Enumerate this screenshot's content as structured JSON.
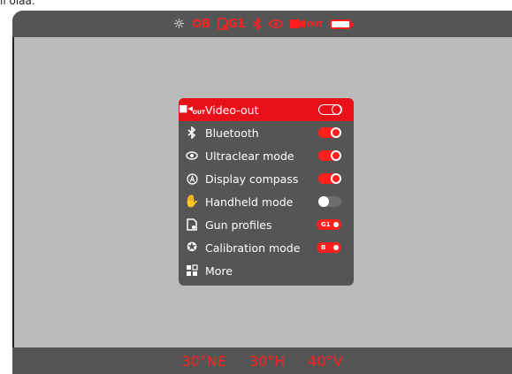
{
  "corner": {
    "text": "ii olaa."
  },
  "status_bar": {
    "items": [
      {
        "icon": "brightness-icon"
      },
      {
        "icon": "calibration-icon",
        "text": "B"
      },
      {
        "icon": "gun-profile-icon",
        "text": "G1"
      },
      {
        "icon": "bluetooth-icon"
      },
      {
        "icon": "eye-icon"
      },
      {
        "icon": "video-out-icon",
        "text": "OUT"
      },
      {
        "icon": "battery-icon"
      }
    ]
  },
  "menu": {
    "items": [
      {
        "label": "Video-out",
        "icon": "video-out-icon",
        "icon_text": "OUT",
        "control": "toggle-on",
        "selected": true
      },
      {
        "label": "Bluetooth",
        "icon": "bluetooth-icon",
        "control": "toggle-on"
      },
      {
        "label": "Ultraclear mode",
        "icon": "eye-icon",
        "control": "toggle-on"
      },
      {
        "label": "Display compass",
        "icon": "compass-icon",
        "control": "toggle-on"
      },
      {
        "label": "Handheld mode",
        "icon": "hand-icon",
        "control": "toggle-off"
      },
      {
        "label": "Gun profiles",
        "icon": "gun-profile-icon",
        "control": "pill",
        "value": "G1"
      },
      {
        "label": "Calibration mode",
        "icon": "calibration-icon",
        "control": "pill",
        "value": "B"
      },
      {
        "label": "More",
        "icon": "more-icon"
      }
    ]
  },
  "bottom_bar": {
    "heading": "30°NE",
    "horizontal": "30°H",
    "vertical": "40°V"
  },
  "colors": {
    "accent": "#ff1f1f",
    "bar_bg": "#555555",
    "screen_bg": "#bbbbbb"
  }
}
